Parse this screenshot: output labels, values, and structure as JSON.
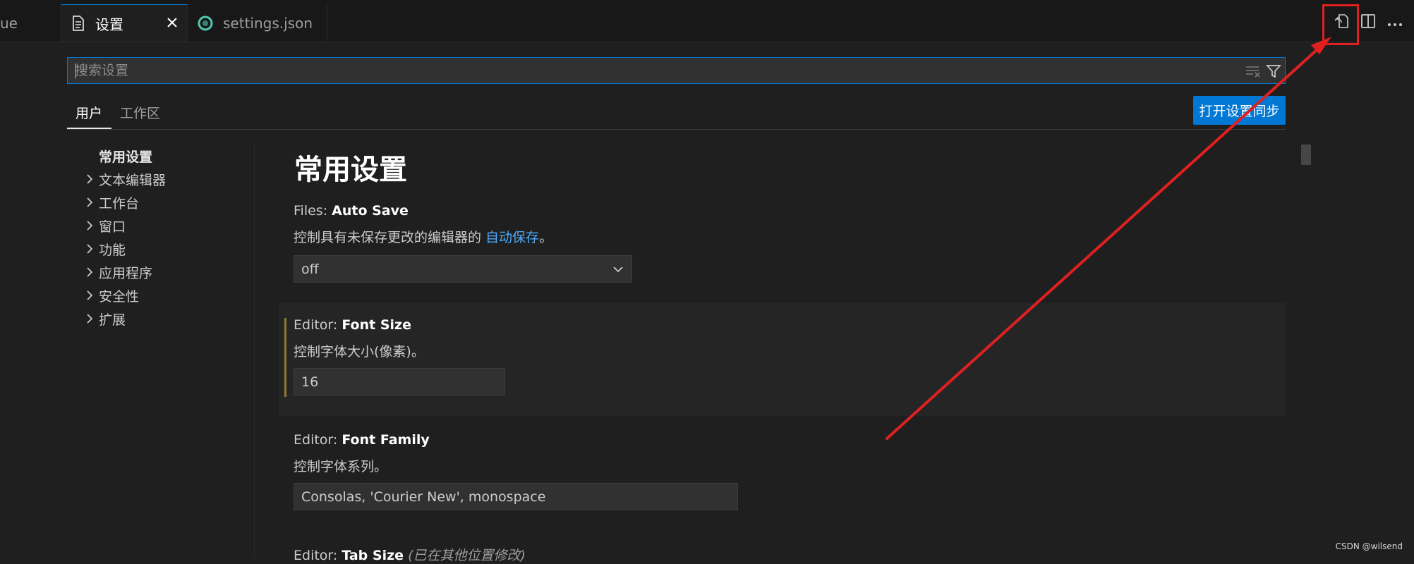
{
  "tabs": {
    "previous_tab_fragment": "ue",
    "settings_tab_label": "设置",
    "settings_json_tab_label": "settings.json",
    "settings_json_icon_color": "#4ec9b0"
  },
  "toolbar": {
    "open_json_icon": "open-settings-json-icon",
    "split_icon": "split-editor-icon",
    "more_icon": "more-actions-icon"
  },
  "search": {
    "placeholder": "搜索设置",
    "value": ""
  },
  "scope_tabs": {
    "user": "用户",
    "workspace": "工作区"
  },
  "sync_button_label": "打开设置同步",
  "toc": [
    {
      "label": "常用设置",
      "expandable": false,
      "active": true
    },
    {
      "label": "文本编辑器",
      "expandable": true,
      "active": false
    },
    {
      "label": "工作台",
      "expandable": true,
      "active": false
    },
    {
      "label": "窗口",
      "expandable": true,
      "active": false
    },
    {
      "label": "功能",
      "expandable": true,
      "active": false
    },
    {
      "label": "应用程序",
      "expandable": true,
      "active": false
    },
    {
      "label": "安全性",
      "expandable": true,
      "active": false
    },
    {
      "label": "扩展",
      "expandable": true,
      "active": false
    }
  ],
  "section_title": "常用设置",
  "settings": {
    "auto_save": {
      "category": "Files: ",
      "name": "Auto Save",
      "desc_prefix": "控制具有未保存更改的编辑器的 ",
      "desc_link": "自动保存",
      "desc_suffix": "。",
      "value": "off"
    },
    "font_size": {
      "category": "Editor: ",
      "name": "Font Size",
      "desc": "控制字体大小(像素)。",
      "value": "16"
    },
    "font_family": {
      "category": "Editor: ",
      "name": "Font Family",
      "desc": "控制字体系列。",
      "value": "Consolas, 'Courier New', monospace"
    },
    "tab_size": {
      "category": "Editor: ",
      "name": "Tab Size",
      "note": "(已在其他位置修改)"
    }
  },
  "colors": {
    "accent": "#0078d4",
    "annotation_red": "#e02020",
    "modified_indicator": "#8f7a2f"
  },
  "watermark": "CSDN @wilsend"
}
